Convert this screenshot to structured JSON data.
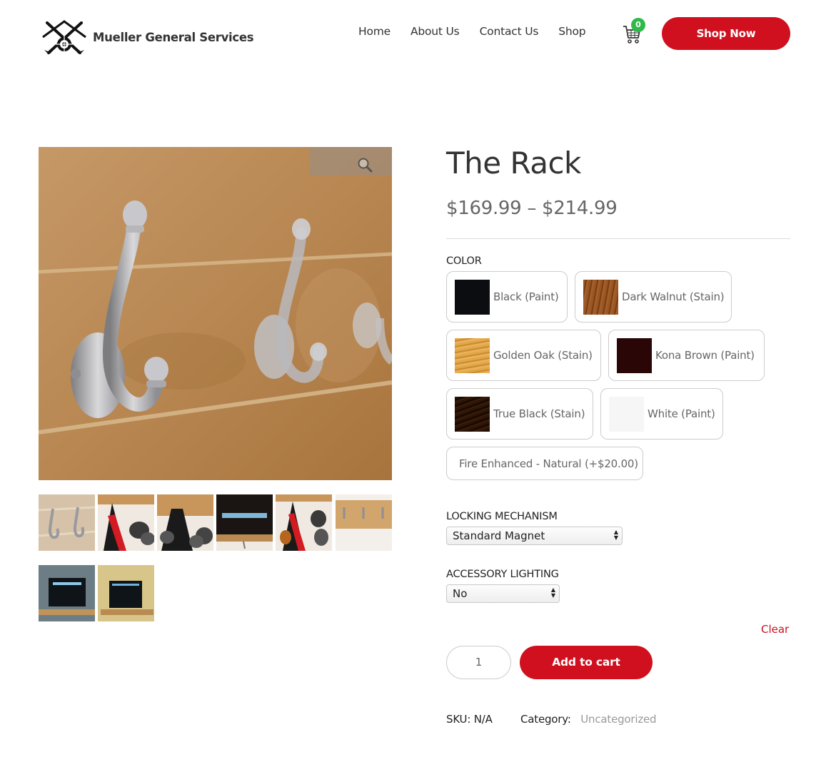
{
  "header": {
    "logo_text": "Mueller General Services",
    "nav": [
      "Home",
      "About Us",
      "Contact Us",
      "Shop"
    ],
    "cart_count": "0",
    "shop_now_label": "Shop Now"
  },
  "product": {
    "title": "The Rack",
    "price": "$169.99 – $214.99",
    "color_label": "COLOR",
    "colors": [
      {
        "name": "Black (Paint)",
        "hex": "#0b0d11"
      },
      {
        "name": "Dark Walnut (Stain)",
        "hex": "#8a4a1c"
      },
      {
        "name": "Golden Oak (Stain)",
        "hex": "#d89a3a"
      },
      {
        "name": "Kona Brown (Paint)",
        "hex": "#2a0606"
      },
      {
        "name": "True Black (Stain)",
        "hex": "#2a1306"
      },
      {
        "name": "White (Paint)",
        "hex": "#f6f6f6"
      },
      {
        "name": "Fire Enhanced - Natural (+$20.00)"
      }
    ],
    "locking_label": "LOCKING MECHANISM",
    "locking_value": "Standard Magnet",
    "lighting_label": "ACCESSORY LIGHTING",
    "lighting_value": "No",
    "clear_label": "Clear",
    "quantity": "1",
    "add_to_cart_label": "Add to cart",
    "sku_label": "SKU:",
    "sku_value": "N/A",
    "category_label": "Category:",
    "category_value": "Uncategorized"
  },
  "icons": {
    "zoom": "magnifier-icon",
    "cart": "cart-icon",
    "select_arrows": "updown-arrows-icon"
  },
  "colors": {
    "accent": "#d0101f",
    "cart_badge": "#2fb94a"
  }
}
